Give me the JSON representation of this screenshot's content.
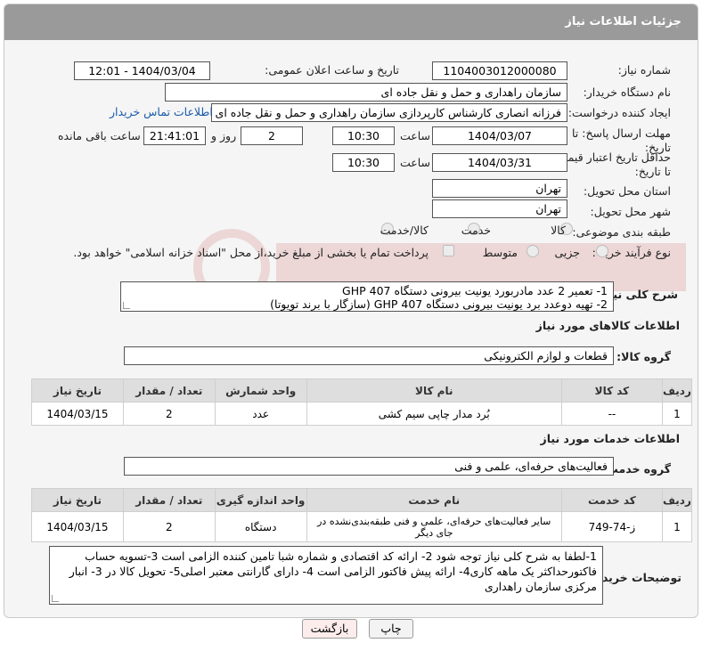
{
  "header": {
    "title": "جزئیات اطلاعات نیاز"
  },
  "form": {
    "need_number_label": "شماره نیاز:",
    "need_number": "1104003012000080",
    "announce_label": "تاریخ و ساعت اعلان عمومی:",
    "announce_value": "1404/03/04 - 12:01",
    "buyer_org_label": "نام دستگاه خریدار:",
    "buyer_org": "سازمان راهداری و حمل و نقل جاده ای",
    "requester_label": "ایجاد کننده درخواست:",
    "requester": "فرزانه انصاری کارشناس کارپردازی سازمان راهداری و حمل و نقل جاده ای",
    "contact_link": "اطلاعات تماس خریدار",
    "deadline_label": "مهلت ارسال پاسخ: تا تاریخ:",
    "deadline_date": "1404/03/07",
    "time_label": "ساعت",
    "deadline_time": "10:30",
    "days_value": "2",
    "days_label": "روز و",
    "remaining_time": "21:41:01",
    "remaining_label": "ساعت باقی مانده",
    "price_validity_label": "حداقل تاریخ اعتبار قیمت: تا تاریخ:",
    "price_validity_date": "1404/03/31",
    "price_validity_time": "10:30",
    "province_label": "استان محل تحویل:",
    "province": "تهران",
    "city_label": "شهر محل تحویل:",
    "city": "تهران",
    "category_label": "طبقه بندی موضوعی:",
    "category_options": [
      "کالا",
      "خدمت",
      "کالا/خدمت"
    ],
    "process_label": "نوع فرآیند خرید :",
    "process_options": [
      "جزیی",
      "متوسط"
    ],
    "payment_note": "پرداخت تمام یا بخشی از مبلغ خرید،از محل \"اسناد خزانه اسلامی\" خواهد بود."
  },
  "description": {
    "label": "شرح کلی نیاز:",
    "lines": [
      "1- تعمیر 2 عدد مادربورد یونیت بیرونی دستگاه  GHP 407",
      "2- تهیه دوعدد برد یونیت بیرونی دستگاه GHP 407 (سازگار با برند تویوتا)"
    ]
  },
  "goods": {
    "section_title": "اطلاعات کالاهای مورد نیاز",
    "group_label": "گروه کالا:",
    "group_value": "قطعات و لوازم الکترونیکی",
    "columns": [
      "ردیف",
      "کد کالا",
      "نام کالا",
      "واحد شمارش",
      "تعداد / مقدار",
      "تاریخ نیاز"
    ],
    "rows": [
      [
        "1",
        "--",
        "بُرد مدار چاپی سیم کشی",
        "عدد",
        "2",
        "1404/03/15"
      ]
    ]
  },
  "services": {
    "section_title": "اطلاعات خدمات مورد نیاز",
    "group_label": "گروه خدمت:",
    "group_value": "فعالیت‌های حرفه‌ای، علمی و فنی",
    "columns": [
      "ردیف",
      "کد خدمت",
      "نام خدمت",
      "واحد اندازه گیری",
      "تعداد / مقدار",
      "تاریخ نیاز"
    ],
    "rows": [
      [
        "1",
        "ز-74-749",
        "سایر فعالیت‌های حرفه‌ای، علمی و فنی طبقه‌بندی‌نشده در جای دیگر",
        "دستگاه",
        "2",
        "1404/03/15"
      ]
    ]
  },
  "buyer_notes": {
    "label": "توضیحات خریدار:",
    "text": "1-لطفا به شرح کلی نیاز توجه شود 2- ارائه کد اقتصادی و شماره شبا تامین کننده الزامی است 3-تسویه حساب فاکتورحداکثر یک ماهه کاری4- ارائه پیش فاکتور الزامی است 4- دارای گارانتی معتبر اصلی5- تحویل کالا در 3- انبار مرکزی سازمان راهداری"
  },
  "buttons": {
    "print": "چاپ",
    "back": "بازگشت"
  }
}
